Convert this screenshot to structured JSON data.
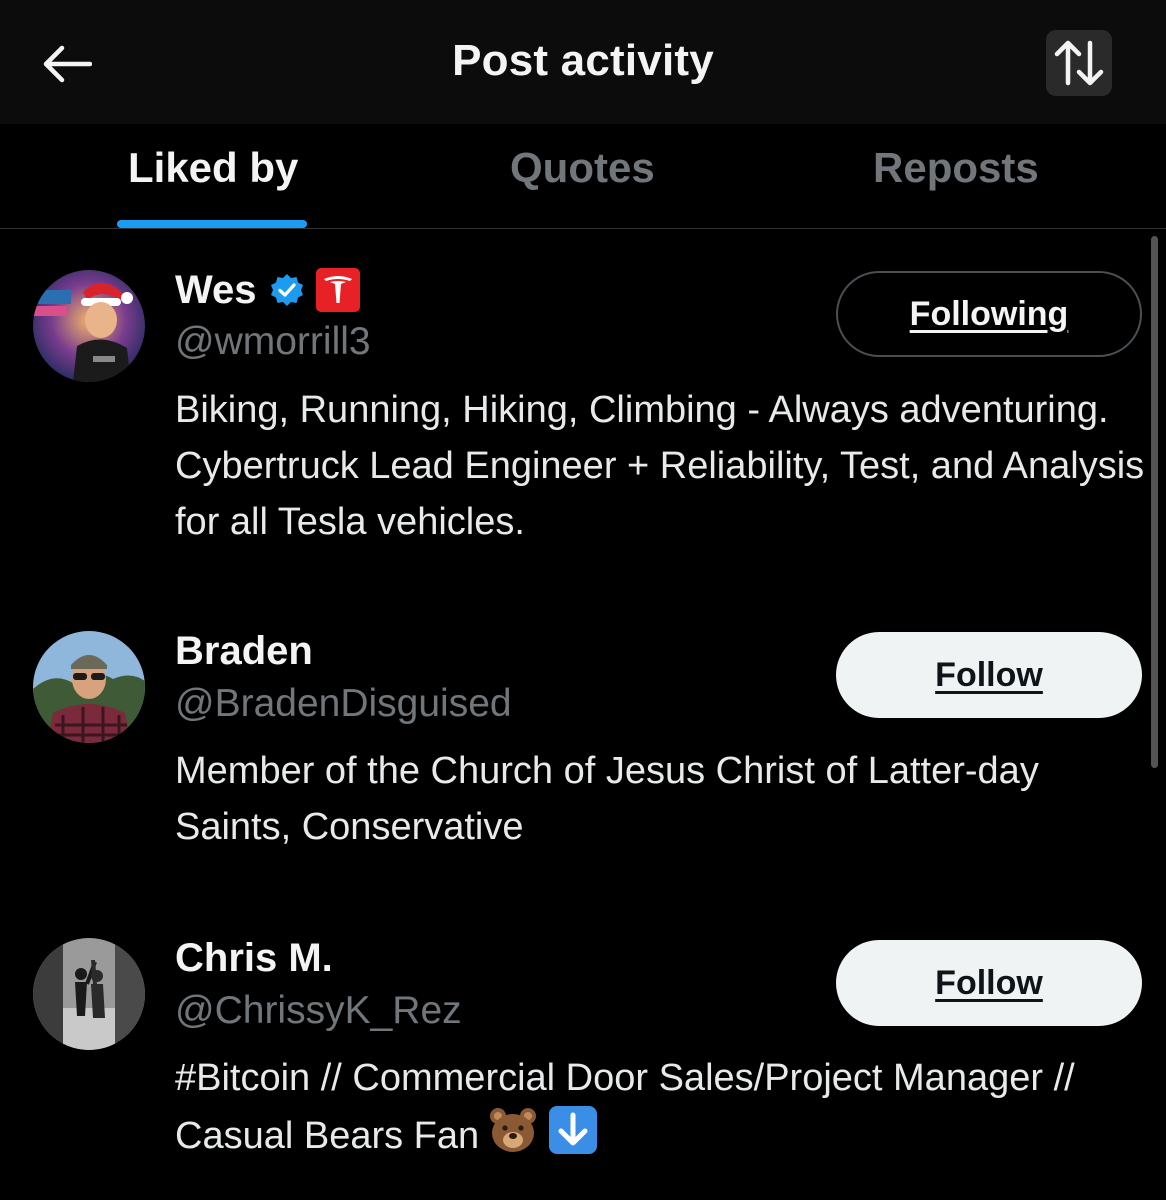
{
  "header": {
    "title": "Post activity",
    "back_icon": "arrow-left-icon",
    "sort_icon": "sort-arrows-icon"
  },
  "tabs": [
    {
      "label": "Liked by",
      "active": true
    },
    {
      "label": "Quotes",
      "active": false
    },
    {
      "label": "Reposts",
      "active": false
    }
  ],
  "colors": {
    "accent": "#1d9bf0",
    "verified": "#1d9bf0",
    "tesla_badge": "#e82127",
    "muted_text": "#71767b"
  },
  "users": [
    {
      "name": "Wes",
      "handle": "@wmorrill3",
      "verified": true,
      "affiliation_badge": "tesla-logo-icon",
      "button": "Following",
      "bio": "Biking, Running, Hiking, Climbing - Always adventuring. Cybertruck Lead Engineer + Reliability, Test, and Analysis for all Tesla vehicles."
    },
    {
      "name": "Braden",
      "handle": "@BradenDisguised",
      "verified": false,
      "button": "Follow",
      "bio": "Member of the Church of Jesus Christ of Latter-day Saints, Conservative"
    },
    {
      "name": "Chris M.",
      "handle": "@ChrissyK_Rez",
      "verified": false,
      "button": "Follow",
      "bio": "#Bitcoin // Commercial Door Sales/Project Manager // Casual Bears Fan",
      "bio_emojis": [
        "bear-emoji-icon",
        "down-arrow-emoji-icon"
      ]
    }
  ]
}
